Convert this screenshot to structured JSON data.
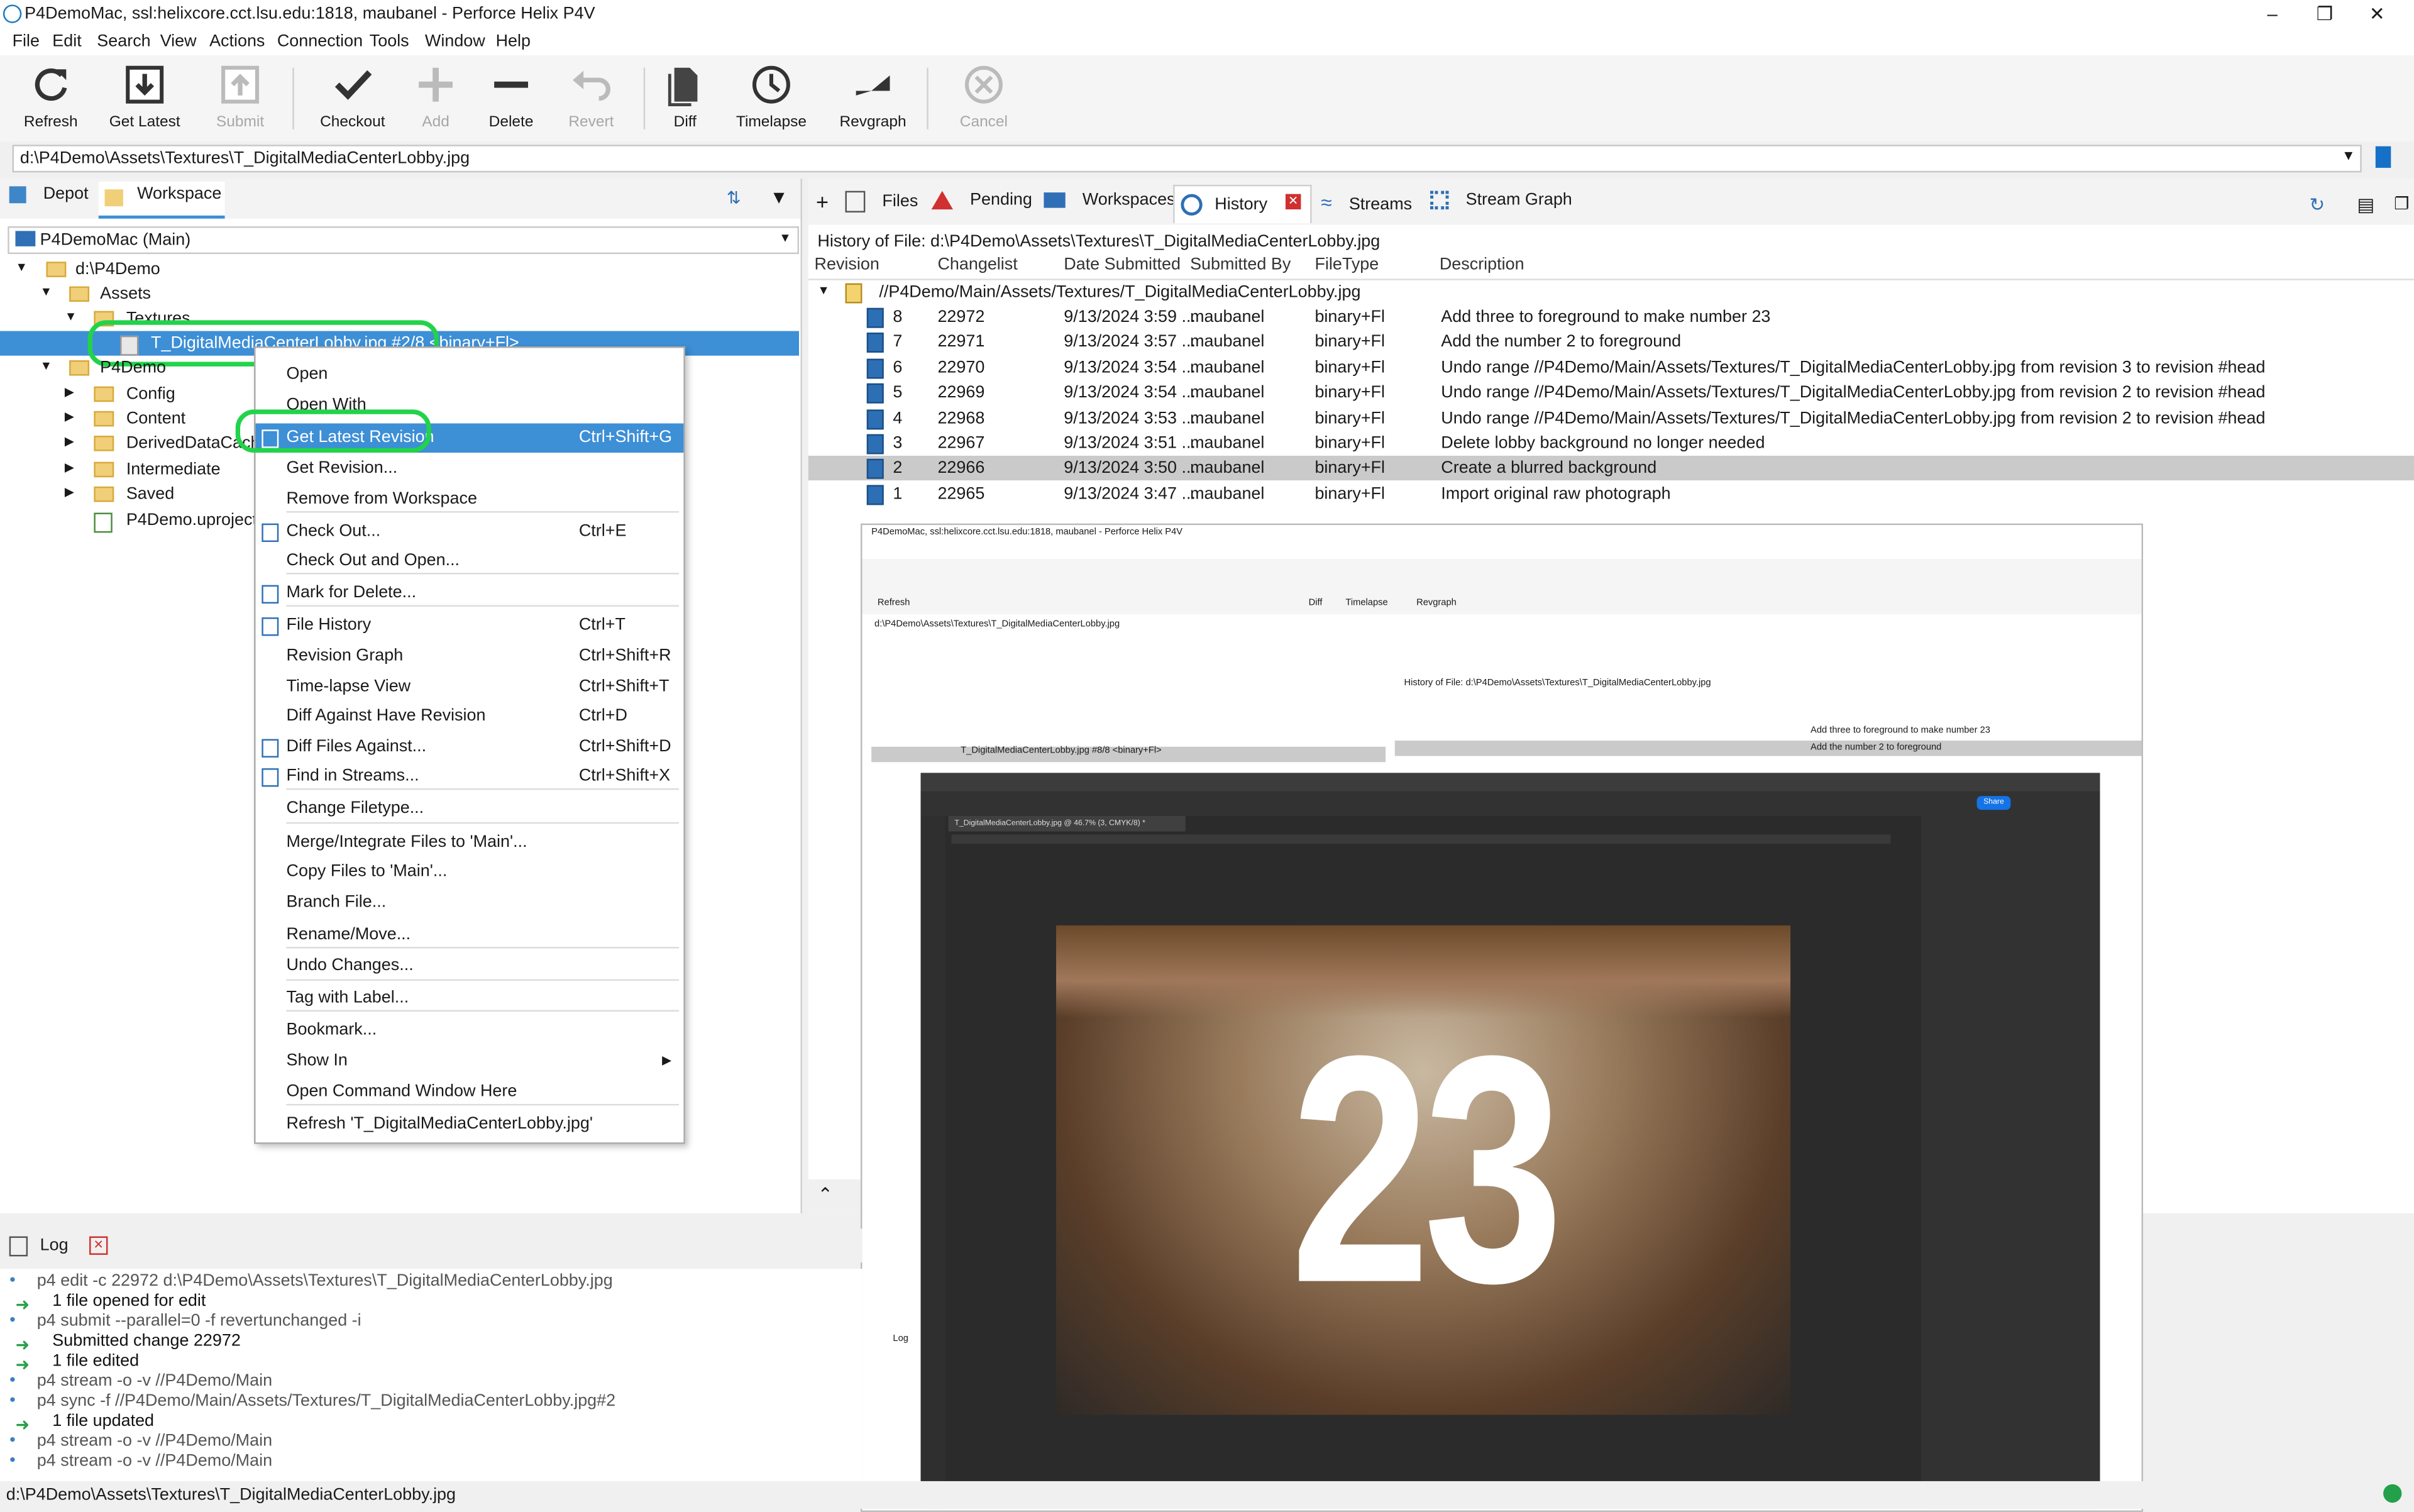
{
  "window": {
    "title": "P4DemoMac,  ssl:helixcore.cct.lsu.edu:1818,  maubanel - Perforce Helix P4V"
  },
  "menubar": [
    "File",
    "Edit",
    "Search",
    "View",
    "Actions",
    "Connection",
    "Tools",
    "Window",
    "Help"
  ],
  "toolbar": {
    "refresh": "Refresh",
    "get_latest": "Get Latest",
    "submit": "Submit",
    "checkout": "Checkout",
    "add": "Add",
    "delete": "Delete",
    "revert": "Revert",
    "diff": "Diff",
    "timelapse": "Timelapse",
    "revgraph": "Revgraph",
    "cancel": "Cancel"
  },
  "address": "d:\\P4Demo\\Assets\\Textures\\T_DigitalMediaCenterLobby.jpg",
  "left": {
    "tab_depot": "Depot",
    "tab_workspace": "Workspace",
    "workspace_select": "P4DemoMac (Main)",
    "tree": {
      "root": "d:\\P4Demo",
      "assets": "Assets",
      "textures": "Textures",
      "selected_file": "T_DigitalMediaCenterLobby.jpg #2/8 <binary+Fl>",
      "p4demo": "P4Demo",
      "config": "Config",
      "content": "Content",
      "deriveddatacache": "DerivedDataCache",
      "intermediate": "Intermediate",
      "saved": "Saved",
      "uproject": "P4Demo.uproject #"
    }
  },
  "context_menu": [
    {
      "label": "Open",
      "shortcut": ""
    },
    {
      "label": "Open With",
      "shortcut": ""
    },
    {
      "label": "Get Latest Revision",
      "shortcut": "Ctrl+Shift+G"
    },
    {
      "label": "Get Revision...",
      "shortcut": ""
    },
    {
      "label": "Remove from Workspace",
      "shortcut": ""
    },
    {
      "label": "Check Out...",
      "shortcut": "Ctrl+E"
    },
    {
      "label": "Check Out and Open...",
      "shortcut": ""
    },
    {
      "label": "Mark for Delete...",
      "shortcut": ""
    },
    {
      "label": "File History",
      "shortcut": "Ctrl+T"
    },
    {
      "label": "Revision Graph",
      "shortcut": "Ctrl+Shift+R"
    },
    {
      "label": "Time-lapse View",
      "shortcut": "Ctrl+Shift+T"
    },
    {
      "label": "Diff Against Have Revision",
      "shortcut": "Ctrl+D"
    },
    {
      "label": "Diff Files Against...",
      "shortcut": "Ctrl+Shift+D"
    },
    {
      "label": "Find in Streams...",
      "shortcut": "Ctrl+Shift+X"
    },
    {
      "label": "Change Filetype...",
      "shortcut": ""
    },
    {
      "label": "Merge/Integrate Files to 'Main'...",
      "shortcut": ""
    },
    {
      "label": "Copy Files to 'Main'...",
      "shortcut": ""
    },
    {
      "label": "Branch File...",
      "shortcut": ""
    },
    {
      "label": "Rename/Move...",
      "shortcut": ""
    },
    {
      "label": "Undo Changes...",
      "shortcut": ""
    },
    {
      "label": "Tag with Label...",
      "shortcut": ""
    },
    {
      "label": "Bookmark...",
      "shortcut": ""
    },
    {
      "label": "Show In",
      "shortcut": ""
    },
    {
      "label": "Open Command Window Here",
      "shortcut": ""
    },
    {
      "label": "Refresh 'T_DigitalMediaCenterLobby.jpg'",
      "shortcut": ""
    }
  ],
  "right": {
    "tabs": [
      "Files",
      "Pending",
      "Workspaces",
      "History",
      "Streams",
      "Stream Graph"
    ],
    "history_of": "History of File:  d:\\P4Demo\\Assets\\Textures\\T_DigitalMediaCenterLobby.jpg",
    "columns": [
      "Revision",
      "Changelist",
      "Date Submitted",
      "Submitted By",
      "FileType",
      "Description"
    ],
    "depot_path": "//P4Demo/Main/Assets/Textures/T_DigitalMediaCenterLobby.jpg",
    "rows": [
      {
        "rev": "8",
        "cl": "22972",
        "date": "9/13/2024 3:59 ...",
        "by": "maubanel",
        "type": "binary+Fl",
        "desc": "Add three to foreground to make number 23"
      },
      {
        "rev": "7",
        "cl": "22971",
        "date": "9/13/2024 3:57 ...",
        "by": "maubanel",
        "type": "binary+Fl",
        "desc": "Add the number 2 to foreground"
      },
      {
        "rev": "6",
        "cl": "22970",
        "date": "9/13/2024 3:54 ...",
        "by": "maubanel",
        "type": "binary+Fl",
        "desc": "Undo range //P4Demo/Main/Assets/Textures/T_DigitalMediaCenterLobby.jpg from revision 3 to revision #head"
      },
      {
        "rev": "5",
        "cl": "22969",
        "date": "9/13/2024 3:54 ...",
        "by": "maubanel",
        "type": "binary+Fl",
        "desc": "Undo range //P4Demo/Main/Assets/Textures/T_DigitalMediaCenterLobby.jpg from revision 2 to revision #head"
      },
      {
        "rev": "4",
        "cl": "22968",
        "date": "9/13/2024 3:53 ...",
        "by": "maubanel",
        "type": "binary+Fl",
        "desc": "Undo range //P4Demo/Main/Assets/Textures/T_DigitalMediaCenterLobby.jpg from revision 2 to revision #head"
      },
      {
        "rev": "3",
        "cl": "22967",
        "date": "9/13/2024 3:51 ...",
        "by": "maubanel",
        "type": "binary+Fl",
        "desc": "Delete lobby background no longer needed"
      },
      {
        "rev": "2",
        "cl": "22966",
        "date": "9/13/2024 3:50 ...",
        "by": "maubanel",
        "type": "binary+Fl",
        "desc": "Create a blurred background"
      },
      {
        "rev": "1",
        "cl": "22965",
        "date": "9/13/2024 3:47 ...",
        "by": "maubanel",
        "type": "binary+Fl",
        "desc": "Import original raw photograph"
      }
    ]
  },
  "log": {
    "tab": "Log",
    "lines": [
      "p4 edit -c 22972 d:\\P4Demo\\Assets\\Textures\\T_DigitalMediaCenterLobby.jpg",
      "1 file opened for edit",
      "p4 submit --parallel=0 -f revertunchanged -i",
      "Submitted change 22972",
      "1 file edited",
      "p4 stream -o -v //P4Demo/Main",
      "p4 sync -f //P4Demo/Main/Assets/Textures/T_DigitalMediaCenterLobby.jpg#2",
      "1 file updated",
      "p4 stream -o -v //P4Demo/Main",
      "p4 stream -o -v //P4Demo/Main"
    ]
  },
  "status": "d:\\P4Demo\\Assets\\Textures\\T_DigitalMediaCenterLobby.jpg",
  "overlay": {
    "mini_title": "P4DemoMac,  ssl:helixcore.cct.lsu.edu:1818,  maubanel - Perforce Helix P4V",
    "mini_selected": "T_DigitalMediaCenterLobby.jpg #8/8 <binary+Fl>",
    "ps_doc_tab": "T_DigitalMediaCenterLobby.jpg @ 46.7% (3, CMYK/8) *",
    "number": "23",
    "share": "Share"
  },
  "colors": {
    "accent": "#3d8fd6",
    "highlight_ring": "#22d34a",
    "selection_row": "#cacaca",
    "ps_bg": "#2b2b2b"
  }
}
